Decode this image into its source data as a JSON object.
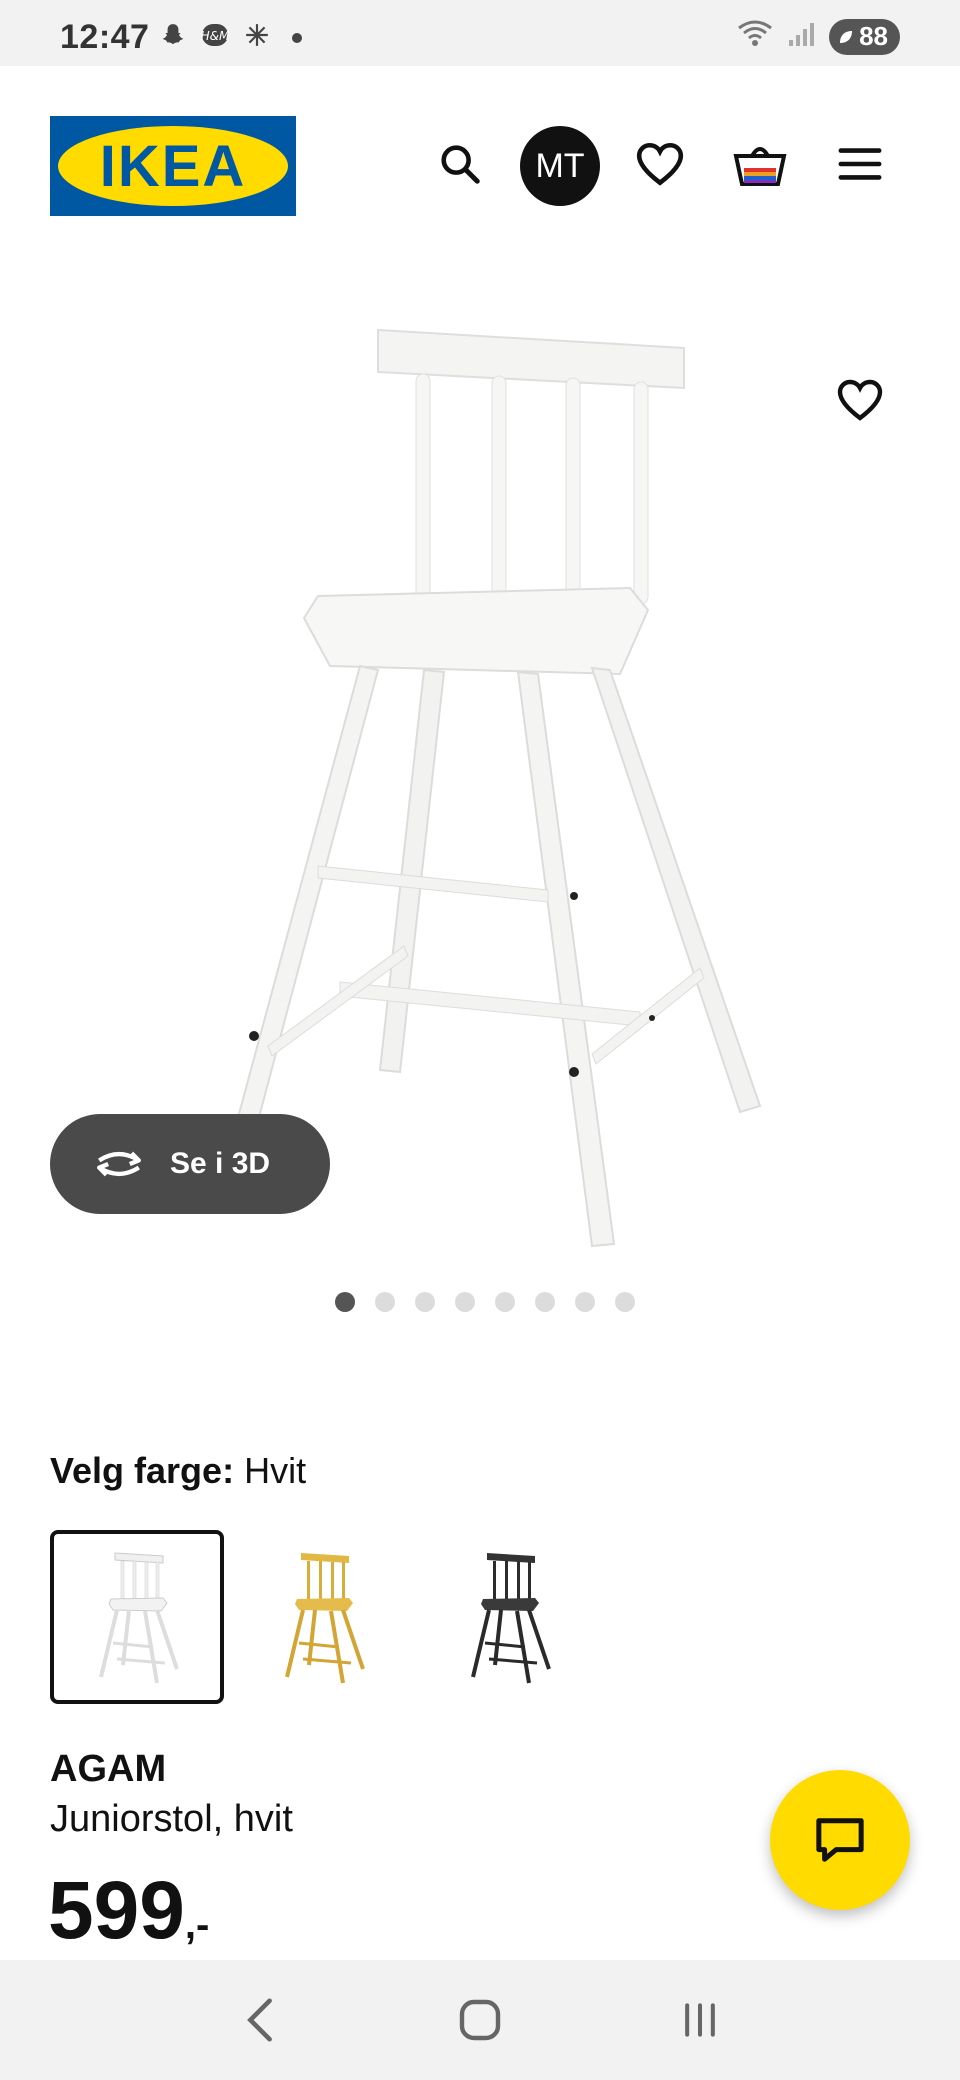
{
  "status_bar": {
    "time": "12:47",
    "battery": "88"
  },
  "header": {
    "logo_text": "IKEA",
    "avatar_initials": "MT"
  },
  "product_gallery": {
    "button_3d_label": "Se i 3D",
    "dots_count": 8,
    "active_dot": 0
  },
  "color_picker": {
    "label": "Velg farge:",
    "selected_value": "Hvit",
    "options": [
      {
        "color": "#f5f5f5",
        "name": "white"
      },
      {
        "color": "#e2b743",
        "name": "yellow"
      },
      {
        "color": "#333333",
        "name": "black"
      }
    ]
  },
  "product": {
    "name": "AGAM",
    "description": "Juniorstol, hvit",
    "price": "599",
    "price_suffix": ",-"
  },
  "colors": {
    "brand_blue": "#0058a3",
    "brand_yellow": "#ffdb00"
  }
}
